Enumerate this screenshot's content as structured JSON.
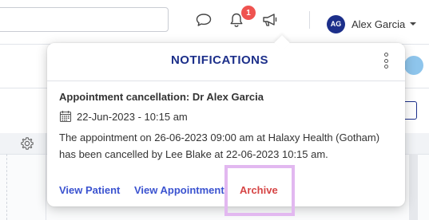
{
  "header": {
    "search": {
      "value": "",
      "placeholder": ""
    },
    "icons": [
      "chat-bubble-icon",
      "bell-icon",
      "megaphone-icon"
    ],
    "notification_count": "1",
    "user": {
      "initials": "AG",
      "name": "Alex Garcia"
    }
  },
  "notifications": {
    "title": "NOTIFICATIONS",
    "items": [
      {
        "title": "Appointment cancellation: Dr Alex Garcia",
        "date": "22-Jun-2023 - 10:15 am",
        "body": "The appointment on 26-06-2023 09:00 am at Halaxy Health (Gotham) has been cancelled by Lee Blake at 22-06-2023 10:15 am.",
        "actions": {
          "view_patient": "View Patient",
          "view_appointment": "View Appointment",
          "archive": "Archive"
        }
      }
    ]
  },
  "colors": {
    "brand_navy": "#1c2f8a",
    "link_blue": "#3b53d0",
    "archive_red": "#d64545",
    "badge_red": "#ef5350",
    "highlight": "#e2b8f0"
  }
}
